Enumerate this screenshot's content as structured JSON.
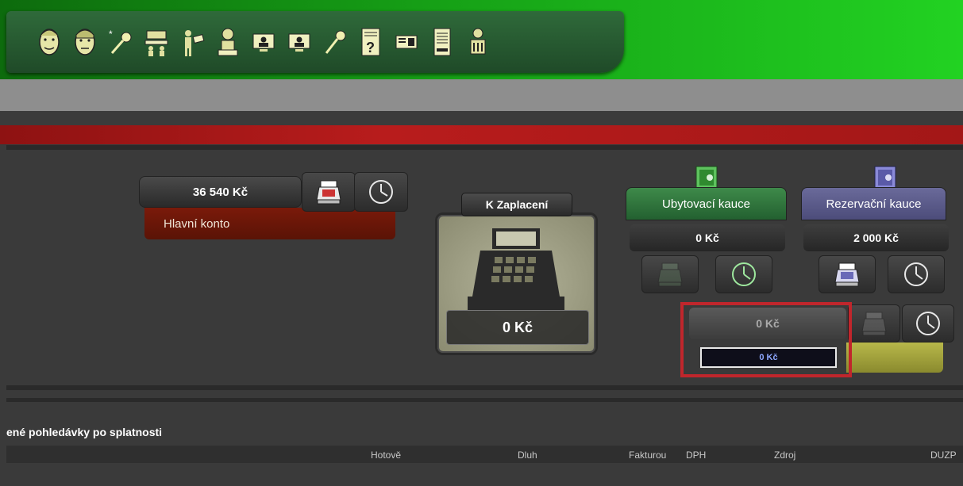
{
  "toolbar": {
    "items": [
      {
        "icon": "guest-face-icon"
      },
      {
        "icon": "guest-face-2-icon"
      },
      {
        "icon": "new-key-icon"
      },
      {
        "icon": "reception-desk-icon"
      },
      {
        "icon": "payment-person-icon"
      },
      {
        "icon": "cashier-icon"
      },
      {
        "icon": "monitor-guest-icon"
      },
      {
        "icon": "monitor-guest-2-icon"
      },
      {
        "icon": "key-icon"
      },
      {
        "icon": "help-document-icon"
      },
      {
        "icon": "id-card-icon"
      },
      {
        "icon": "invoice-document-icon"
      },
      {
        "icon": "bank-person-icon"
      }
    ]
  },
  "main_account": {
    "amount": "36 540 Kč",
    "label": "Hlavní konto"
  },
  "to_pay": {
    "title": "K Zaplacení",
    "amount": "0 Kč"
  },
  "accommodation_deposit": {
    "title": "Ubytovací kauce",
    "amount": "0 Kč",
    "color": "#2f7a3c"
  },
  "reservation_deposit": {
    "title": "Rezervační kauce",
    "amount": "2 000 Kč",
    "color": "#5a5a8a"
  },
  "highlighted": {
    "button_amount": "0 Kč",
    "input_value": "0 Kč"
  },
  "table": {
    "title": "ené pohledávky po splatnosti",
    "columns": [
      "Hotově",
      "Dluh",
      "Fakturou",
      "DPH",
      "Zdroj",
      "DUZP"
    ]
  }
}
